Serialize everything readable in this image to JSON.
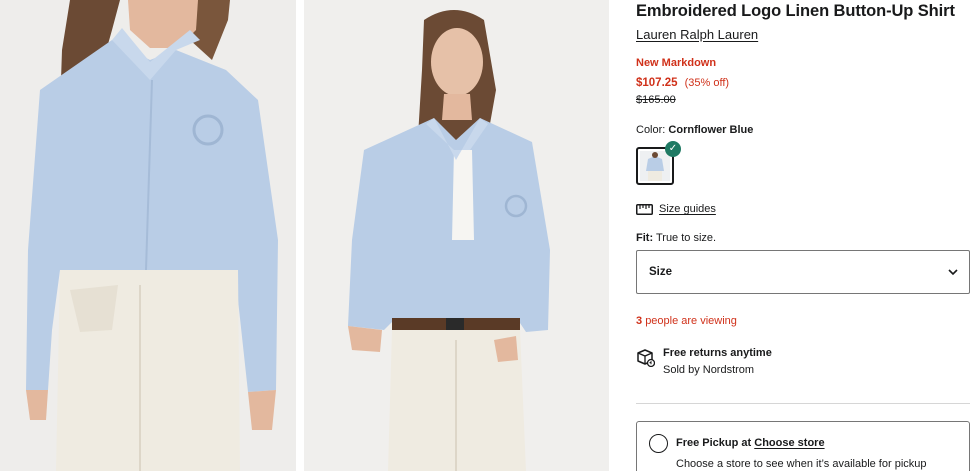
{
  "product": {
    "title": "Embroidered Logo Linen Button-Up Shirt",
    "brand": "Lauren Ralph Lauren",
    "markdown_label": "New Markdown",
    "price": "$107.25",
    "discount": "(35% off)",
    "original_price": "$165.00",
    "color_label": "Color:",
    "color_value": "Cornflower Blue",
    "swatch_check": "✓",
    "size_guides_label": "Size guides",
    "fit_label": "Fit:",
    "fit_value": "True to size.",
    "size_select_label": "Size",
    "size_select_chevron": "⌄",
    "viewing_count": "3",
    "viewing_text": "people are viewing",
    "returns_title": "Free returns anytime",
    "returns_sub": "Sold by Nordstrom",
    "pickup_title": "Free Pickup at",
    "pickup_link": "Choose store",
    "pickup_sub": "Choose a store to see when it’s available for pickup"
  },
  "colors": {
    "sale_red": "#d0311a",
    "check_green": "#1f7a63",
    "shirt_blue": "#b9cde6",
    "jeans_white": "#efebe1"
  },
  "icons": {
    "swatch_check": "check-icon",
    "size_guides": "ruler-icon",
    "size_chevron": "chevron-down-icon",
    "returns": "package-return-icon",
    "pickup_radio": "radio-icon"
  }
}
